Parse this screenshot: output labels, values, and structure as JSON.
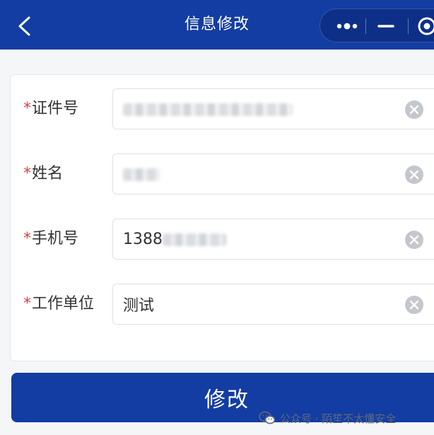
{
  "header": {
    "title": "信息修改",
    "back_icon": "chevron-left-icon",
    "capsule": {
      "more_icon": "more-dots-icon",
      "minimize_icon": "minimize-icon",
      "close_icon": "target-close-icon"
    },
    "color": "#133da3"
  },
  "form": {
    "required_mark": "*",
    "fields": [
      {
        "label": "证件号",
        "value": "",
        "redacted": true
      },
      {
        "label": "姓名",
        "value": "",
        "redacted": true
      },
      {
        "label": "手机号",
        "value": "1388",
        "redacted": true
      },
      {
        "label": "工作单位",
        "value": "测试",
        "redacted": false
      }
    ],
    "clear_icon": "clear-circle-icon",
    "required_color": "#e23b3b"
  },
  "submit": {
    "label": "修改"
  },
  "watermark": {
    "icon": "wechat-icon",
    "text": "公众号 · 陌笙不太懂安全"
  }
}
